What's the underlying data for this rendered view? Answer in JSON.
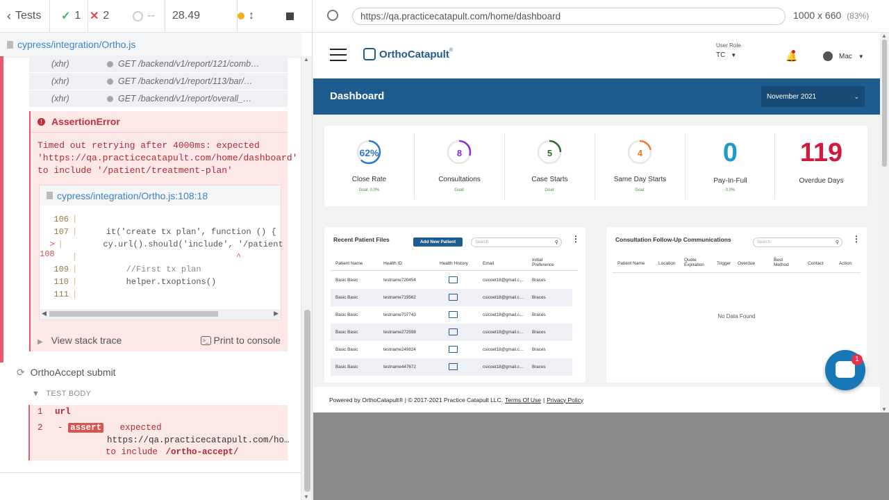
{
  "runner": {
    "tests_label": "Tests",
    "passed": "1",
    "failed": "2",
    "pending": "--",
    "duration": "28.49",
    "spec_path": "cypress/integration/Ortho.js"
  },
  "xhr_rows": [
    {
      "kind": "(xhr)",
      "text": "GET /backend/v1/report/121/comb…"
    },
    {
      "kind": "(xhr)",
      "text": "GET /backend/v1/report/113/bar/…"
    },
    {
      "kind": "(xhr)",
      "text": "GET /backend/v1/report/overall_…"
    }
  ],
  "error": {
    "title": "AssertionError",
    "message": "Timed out retrying after 4000ms: expected\n'https://qa.practicecatapult.com/home/dashboard'\nto include '/patient/treatment-plan'",
    "code_file": "cypress/integration/Ortho.js:108:18",
    "code_lines": [
      {
        "num": "106",
        "marker": "",
        "code": ""
      },
      {
        "num": "107",
        "marker": "",
        "code": "    it('create tx plan', function () {"
      },
      {
        "num": "108",
        "marker": ">",
        "code": "        cy.url().should('include', '/patient"
      },
      {
        "num": "",
        "marker": "",
        "code": "                              ^"
      },
      {
        "num": "109",
        "marker": "",
        "code": "        //First tx plan"
      },
      {
        "num": "110",
        "marker": "",
        "code": "        helper.txoptions()"
      },
      {
        "num": "111",
        "marker": "",
        "code": ""
      }
    ],
    "stack_label": "View stack trace",
    "print_label": "Print to console"
  },
  "test2": {
    "title": "OrthoAccept submit",
    "body_label": "TEST BODY",
    "cmd1_num": "1",
    "cmd1_name": "url",
    "cmd2_num": "2",
    "cmd2_dash": "-",
    "cmd2_badge": "assert",
    "cmd2_line1": "expected",
    "cmd2_line2": "https://qa.practicecatapult.com/ho…",
    "cmd2_line3_pre": "to include",
    "cmd2_line3_val": "/ortho-accept/"
  },
  "browser": {
    "url": "https://qa.practicecatapult.com/home/dashboard",
    "viewport": "1000 x 660",
    "zoom": "(83%)"
  },
  "app": {
    "logo_text": "OrthoCatapult",
    "logo_tm": "®",
    "role_label": "User Role",
    "role_value": "TC",
    "user_name": "Mac",
    "page_title": "Dashboard",
    "month_select": "November 2021",
    "stats": [
      {
        "ring": "62%",
        "label": "Close Rate",
        "goal": "Goal: 0.0%",
        "color": "#2a7ac9",
        "progress": 0.62
      },
      {
        "ring": "8",
        "label": "Consultations",
        "goal": "Goal:",
        "color": "#8e2ad6",
        "progress": 0.3
      },
      {
        "ring": "5",
        "label": "Case Starts",
        "goal": "Goal:",
        "color": "#2f6b2f",
        "progress": 0.25
      },
      {
        "ring": "4",
        "label": "Same Day Starts",
        "goal": "Goal:",
        "color": "#f07a2a",
        "progress": 0.22
      },
      {
        "big": "0",
        "label": "Pay-In-Full",
        "goal": "0.0%",
        "color": "#1e9cc8"
      },
      {
        "big": "119",
        "label": "Overdue Days",
        "goal": "",
        "color": "#d11a3c"
      }
    ],
    "recent": {
      "title": "Recent Patient Files",
      "add_button": "Add New Patient",
      "search_placeholder": "Search",
      "headers": [
        "Patient Name",
        "Health ID",
        "Health History",
        "Email",
        "Initial Preference"
      ],
      "rows": [
        {
          "name": "Basic Basic",
          "id": "testname720454",
          "email": "csicoet18@gmail.c…",
          "pref": "Braces"
        },
        {
          "name": "Basic Basic",
          "id": "testname719562",
          "email": "csicoet18@gmail.c…",
          "pref": "Braces"
        },
        {
          "name": "Basic Basic",
          "id": "testname707743",
          "email": "csicoet18@gmail.c…",
          "pref": "Braces"
        },
        {
          "name": "Basic Basic",
          "id": "testname272598",
          "email": "csicoet18@gmail.c…",
          "pref": "Braces"
        },
        {
          "name": "Basic Basic",
          "id": "testname249824",
          "email": "csicoet18@gmail.c…",
          "pref": "Braces"
        },
        {
          "name": "Basic Basic",
          "id": "testname447672",
          "email": "csicoet18@gmail.c…",
          "pref": "Braces"
        }
      ]
    },
    "followup": {
      "title": "Consultation Follow-Up Communications",
      "search_placeholder": "Search",
      "headers": [
        "Patient Name",
        "Location",
        "Quote Expiration",
        "Trigger",
        "Overdue",
        "Best Method",
        "Contact",
        "Action"
      ],
      "empty": "No Data Found"
    },
    "footer": {
      "text": "Powered by OrthoCatapult® | © 2017-2021 Practice Catapult LLC.",
      "terms": "Terms Of Use",
      "sep": "|",
      "privacy": "Privacy Policy"
    },
    "chat_badge": "1"
  }
}
